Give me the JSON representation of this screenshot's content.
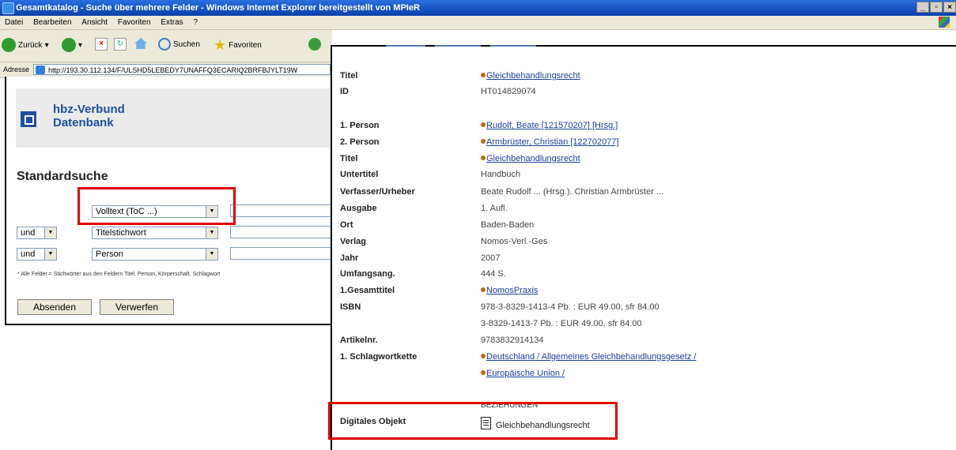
{
  "window": {
    "title": "Gesamtkatalog - Suche über mehrere Felder - Windows Internet Explorer bereitgestellt von MPIeR"
  },
  "menu": [
    "Datei",
    "Bearbeiten",
    "Ansicht",
    "Favoriten",
    "Extras",
    "?"
  ],
  "toolbar": {
    "back": "Zurück",
    "search": "Suchen",
    "favorites": "Favoriten"
  },
  "address": {
    "label": "Adresse",
    "url": "http://193.30.112.134/F/ULSHD5LEBEDY7UNAFFQ3ECARIQ2BRFBJYLT19W"
  },
  "brand": {
    "line1": "hbz-Verbund",
    "line2": "Datenbank"
  },
  "search": {
    "heading": "Standardsuche",
    "rows": [
      {
        "op": "",
        "field": "Volltext (ToC ...)"
      },
      {
        "op": "und",
        "field": "Titelstichwort"
      },
      {
        "op": "und",
        "field": "Person"
      }
    ],
    "hint": "* Alle Felder = Stichwörter aus den Feldern Titel, Person, Körperschaft, Schlagwort",
    "submit": "Absenden",
    "reset": "Verwerfen"
  },
  "record": {
    "title_label": "Titel",
    "title_value": "Gleichbehandlungsrecht",
    "id_label": "ID",
    "id_value": "HT014829074",
    "p1_label": "1. Person",
    "p1_value": "Rudolf, Beate [121570207] [Hrsg.]",
    "p2_label": "2. Person",
    "p2_value": "Armbrüster, Christian [122702077]",
    "title2_label": "Titel",
    "title2_value": "Gleichbehandlungsrecht",
    "subtitle_label": "Untertitel",
    "subtitle_value": "Handbuch",
    "author_label": "Verfasser/Urheber",
    "author_value": "Beate Rudolf ... (Hrsg.). Christian Armbrüster ...",
    "edition_label": "Ausgabe",
    "edition_value": "1. Aufl.",
    "place_label": "Ort",
    "place_value": "Baden-Baden",
    "publisher_label": "Verlag",
    "publisher_value": "Nomos-Verl.-Ges",
    "year_label": "Jahr",
    "year_value": "2007",
    "extent_label": "Umfangsang.",
    "extent_value": "444 S.",
    "series_label": "1.Gesamttitel",
    "series_value": "NomosPraxis",
    "isbn_label": "ISBN",
    "isbn_value1": "978-3-8329-1413-4 Pb. : EUR 49.00, sfr 84.00",
    "isbn_value2": "3-8329-1413-7 Pb. : EUR 49.00, sfr 84.00",
    "article_label": "Artikelnr.",
    "article_value": "9783832914134",
    "subject_label": "1. Schlagwortkette",
    "subject_value1": "Deutschland / Allgemeines Gleichbehandlungsgesetz /",
    "subject_value2": "Europäische Union /",
    "relations": "BEZIEHUNGEN",
    "digital_label": "Digitales Objekt",
    "digital_value": "Gleichbehandlungsrecht"
  },
  "colors": {
    "highlight": "#e00000",
    "link": "#1a3f9e",
    "brand": "#1f4f9e"
  },
  "icons": [
    "app-icon",
    "back-icon",
    "forward-icon",
    "stop-icon",
    "refresh-icon",
    "home-icon",
    "search-icon",
    "favorites-star-icon",
    "history-icon",
    "ie-page-icon",
    "hbz-logo-icon",
    "bullet-icon",
    "document-icon"
  ]
}
